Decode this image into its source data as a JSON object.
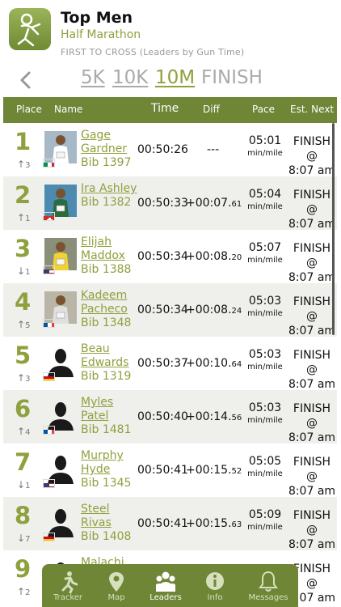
{
  "header": {
    "title": "Top Men",
    "subtitle": "Half Marathon",
    "caption": "FIRST TO CROSS (Leaders by Gun Time)"
  },
  "distances": [
    "5K",
    "10K",
    "10M",
    "FINISH"
  ],
  "active_distance": "10M",
  "table": {
    "headers": {
      "place": "Place",
      "name": "Name",
      "time": "Time",
      "diff": "Diff",
      "pace": "Pace",
      "next": "Est. Next"
    }
  },
  "rows": [
    {
      "place": "1",
      "trend_dir": "up",
      "trend": "3",
      "first": "Gage",
      "last": "Gardner",
      "bib": "Bib 1397",
      "time": "00:50:26",
      "diff_main": "---",
      "diff_frac": "",
      "pace": "05:01",
      "pace_unit": "min/mile",
      "next_line1": "FINISH @",
      "next_line2": "8:07 am",
      "flag": "Italy",
      "photo": "runner-photo"
    },
    {
      "place": "2",
      "trend_dir": "up",
      "trend": "1",
      "first": "Ira Ashley",
      "last": "",
      "bib": "Bib 1382",
      "time": "00:50:33",
      "diff_main": "+00:07.",
      "diff_frac": "61",
      "pace": "05:04",
      "pace_unit": "min/mile",
      "next_line1": "FINISH @",
      "next_line2": "8:07 am",
      "flag": "Switzerland",
      "photo": "runner-photo"
    },
    {
      "place": "3",
      "trend_dir": "down",
      "trend": "1",
      "first": "Elijah",
      "last": "Maddox",
      "bib": "Bib 1388",
      "time": "00:50:34",
      "diff_main": "+00:08.",
      "diff_frac": "20",
      "pace": "05:07",
      "pace_unit": "min/mile",
      "next_line1": "FINISH @",
      "next_line2": "8:07 am",
      "flag": "USA",
      "photo": "runner-photo"
    },
    {
      "place": "4",
      "trend_dir": "up",
      "trend": "5",
      "first": "Kadeem",
      "last": "Pacheco",
      "bib": "Bib 1348",
      "time": "00:50:34",
      "diff_main": "+00:08.",
      "diff_frac": "24",
      "pace": "05:03",
      "pace_unit": "min/mile",
      "next_line1": "FINISH @",
      "next_line2": "8:07 am",
      "flag": "France",
      "photo": "runner-photo"
    },
    {
      "place": "5",
      "trend_dir": "up",
      "trend": "3",
      "first": "Beau",
      "last": "Edwards",
      "bib": "Bib 1319",
      "time": "00:50:37",
      "diff_main": "+00:10.",
      "diff_frac": "64",
      "pace": "05:03",
      "pace_unit": "min/mile",
      "next_line1": "FINISH @",
      "next_line2": "8:07 am",
      "flag": "Spain",
      "photo": "silhouette"
    },
    {
      "place": "6",
      "trend_dir": "up",
      "trend": "4",
      "first": "Myles",
      "last": "Patel",
      "bib": "Bib 1481",
      "time": "00:50:40",
      "diff_main": "+00:14.",
      "diff_frac": "56",
      "pace": "05:03",
      "pace_unit": "min/mile",
      "next_line1": "FINISH @",
      "next_line2": "8:07 am",
      "flag": "France",
      "photo": "silhouette"
    },
    {
      "place": "7",
      "trend_dir": "down",
      "trend": "1",
      "first": "Murphy",
      "last": "Hyde",
      "bib": "Bib 1345",
      "time": "00:50:41",
      "diff_main": "+00:15.",
      "diff_frac": "52",
      "pace": "05:05",
      "pace_unit": "min/mile",
      "next_line1": "FINISH @",
      "next_line2": "8:07 am",
      "flag": "USA",
      "photo": "silhouette"
    },
    {
      "place": "8",
      "trend_dir": "down",
      "trend": "7",
      "first": "Steel",
      "last": "Rivas",
      "bib": "Bib 1408",
      "time": "00:50:41",
      "diff_main": "+00:15.",
      "diff_frac": "63",
      "pace": "05:09",
      "pace_unit": "min/mile",
      "next_line1": "FINISH @",
      "next_line2": "8:07 am",
      "flag": "Spain",
      "photo": "silhouette"
    },
    {
      "place": "9",
      "trend_dir": "up",
      "trend": "2",
      "first": "Malachi",
      "last": "",
      "bib": "",
      "time": "",
      "diff_main": "",
      "diff_frac": "",
      "pace": "",
      "pace_unit": "",
      "next_line1": "FINISH @",
      "next_line2": "8:07 am",
      "flag": "USA",
      "photo": "silhouette"
    }
  ],
  "tabs": [
    {
      "label": "Tracker",
      "icon": "runner-icon"
    },
    {
      "label": "Map",
      "icon": "map-pin-icon"
    },
    {
      "label": "Leaders",
      "icon": "group-icon"
    },
    {
      "label": "Info",
      "icon": "info-icon"
    },
    {
      "label": "Messages",
      "icon": "bell-icon"
    }
  ],
  "active_tab": "Leaders",
  "colors": {
    "accent": "#8ea13e",
    "bar": "#6f8636",
    "alt_row": "#efefeb"
  }
}
